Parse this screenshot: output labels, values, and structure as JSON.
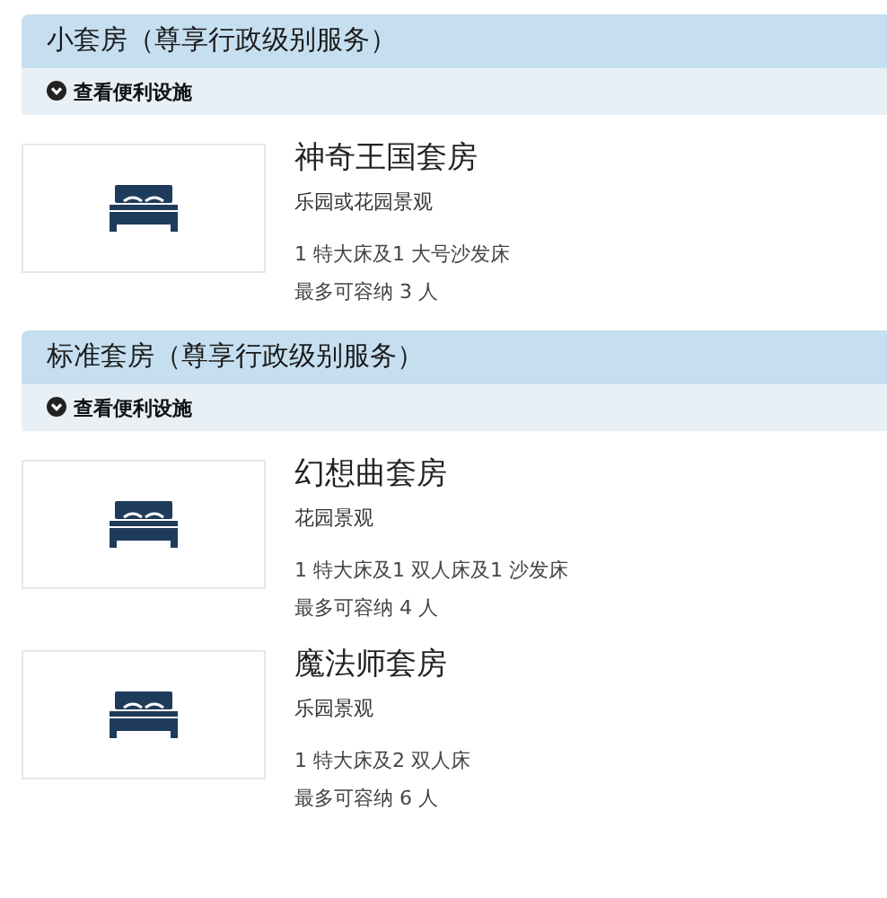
{
  "sections": [
    {
      "title": "小套房（尊享行政级别服务）",
      "amenities_link": "查看便利设施",
      "rooms": [
        {
          "name": "神奇王国套房",
          "view": "乐园或花园景观",
          "beds": "1 特大床及1 大号沙发床",
          "capacity": "最多可容纳 3 人"
        }
      ]
    },
    {
      "title": "标准套房（尊享行政级别服务）",
      "amenities_link": "查看便利设施",
      "rooms": [
        {
          "name": "幻想曲套房",
          "view": "花园景观",
          "beds": "1 特大床及1 双人床及1 沙发床",
          "capacity": "最多可容纳 4 人"
        },
        {
          "name": "魔法师套房",
          "view": "乐园景观",
          "beds": "1 特大床及2 双人床",
          "capacity": "最多可容纳 6 人"
        }
      ]
    }
  ]
}
